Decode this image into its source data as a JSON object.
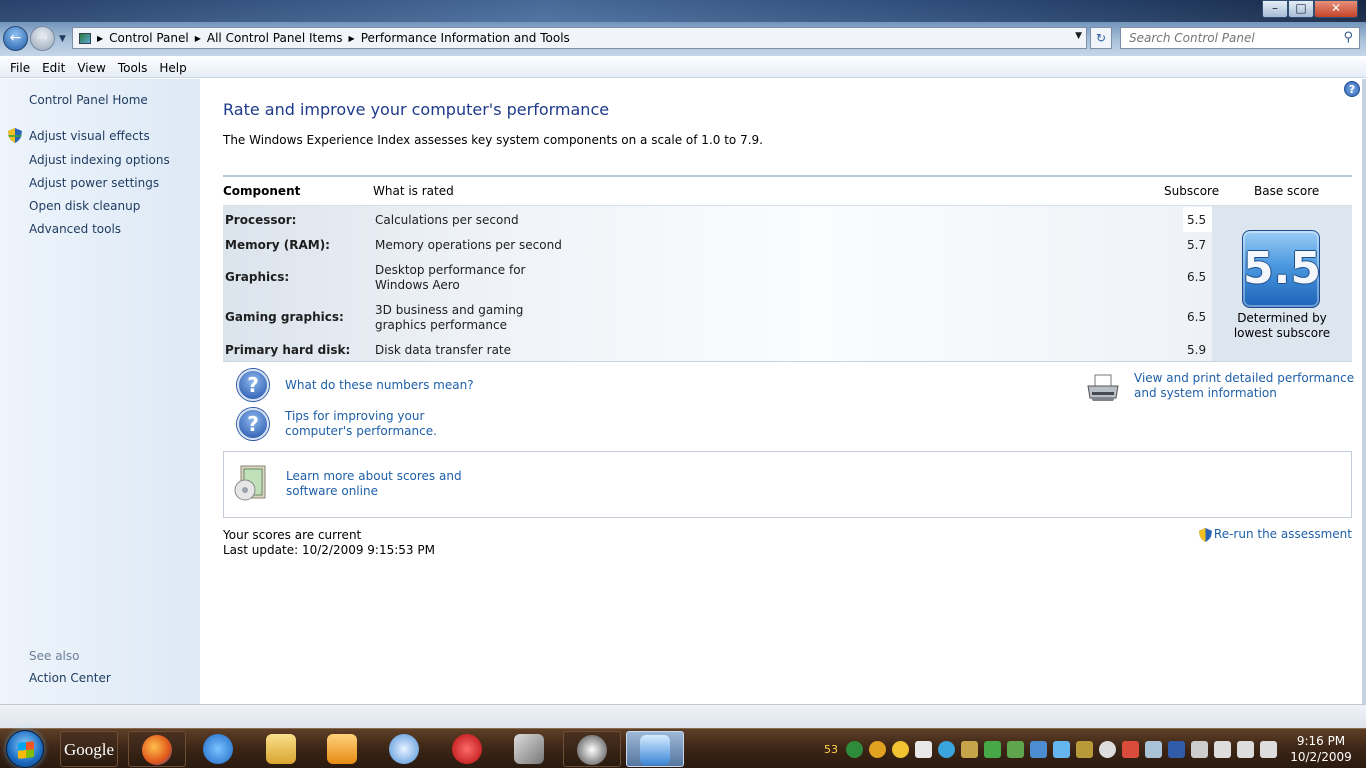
{
  "address": {
    "crumbs": [
      "Control Panel",
      "All Control Panel Items",
      "Performance Information and Tools"
    ]
  },
  "search": {
    "placeholder": "Search Control Panel"
  },
  "menu": [
    "File",
    "Edit",
    "View",
    "Tools",
    "Help"
  ],
  "leftpane": {
    "home": "Control Panel Home",
    "links": [
      "Adjust visual effects",
      "Adjust indexing options",
      "Adjust power settings",
      "Open disk cleanup",
      "Advanced tools"
    ],
    "see_also_label": "See also",
    "see_also_links": [
      "Action Center"
    ]
  },
  "main": {
    "title": "Rate and improve your computer's performance",
    "description": "The Windows Experience Index assesses key system components on a scale of 1.0 to 7.9.",
    "table": {
      "headers": {
        "component": "Component",
        "what": "What is rated",
        "subscore": "Subscore",
        "base": "Base score"
      },
      "rows": [
        {
          "component": "Processor:",
          "what": "Calculations per second",
          "subscore": "5.5"
        },
        {
          "component": "Memory (RAM):",
          "what": "Memory operations per second",
          "subscore": "5.7"
        },
        {
          "component": "Graphics:",
          "what": "Desktop performance for Windows Aero",
          "subscore": "6.5"
        },
        {
          "component": "Gaming graphics:",
          "what": "3D business and gaming graphics performance",
          "subscore": "6.5"
        },
        {
          "component": "Primary hard disk:",
          "what": "Disk data transfer rate",
          "subscore": "5.9"
        }
      ],
      "base_score": "5.5",
      "base_caption": "Determined by lowest subscore"
    },
    "links": {
      "numbers": "What do these numbers mean?",
      "tips": "Tips for improving your computer's performance.",
      "print": "View and print detailed performance and system information",
      "learn": "Learn more about scores and software online",
      "rerun": "Re-run the assessment"
    },
    "status": {
      "current": "Your scores are current",
      "last_update": "Last update: 10/2/2009 9:15:53 PM"
    }
  },
  "taskbar": {
    "google": "Google",
    "tray_counter": "53",
    "clock_time": "9:16 PM",
    "clock_date": "10/2/2009"
  }
}
